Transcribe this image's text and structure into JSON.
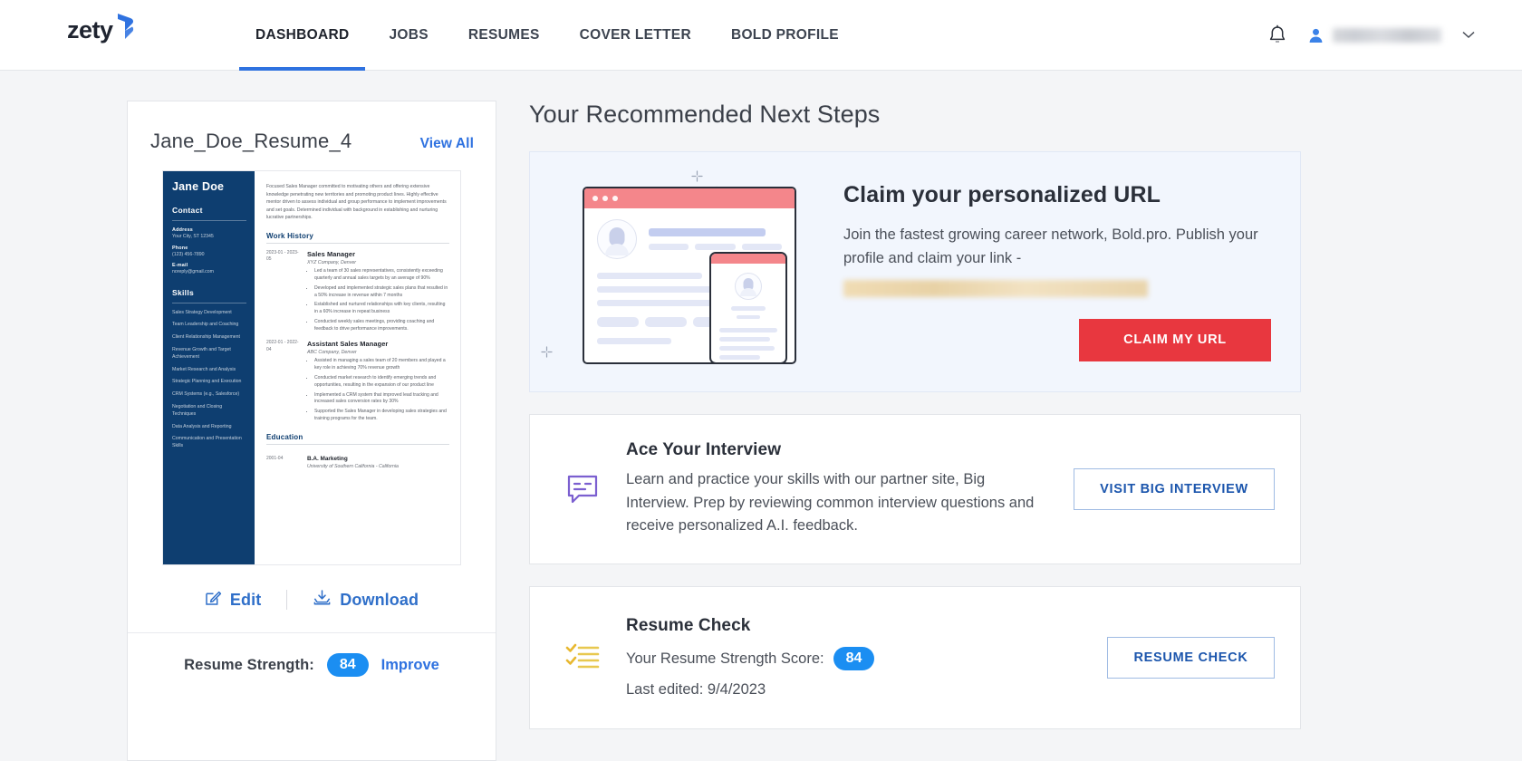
{
  "header": {
    "logo_text": "zety",
    "nav": [
      {
        "label": "DASHBOARD",
        "active": true
      },
      {
        "label": "JOBS",
        "active": false
      },
      {
        "label": "RESUMES",
        "active": false
      },
      {
        "label": "COVER LETTER",
        "active": false
      },
      {
        "label": "BOLD PROFILE",
        "active": false
      }
    ],
    "notification_icon": "bell-icon",
    "account_icon": "user-avatar-icon",
    "account_name_redacted": "",
    "dropdown_icon": "chevron-down-icon"
  },
  "resume_card": {
    "title": "Jane_Doe_Resume_4",
    "view_all_label": "View All",
    "edit_label": "Edit",
    "download_label": "Download",
    "strength_label": "Resume Strength:",
    "strength_score": "84",
    "improve_label": "Improve",
    "preview": {
      "name": "Jane Doe",
      "contact_heading": "Contact",
      "address_label": "Address",
      "address_value": "Your City, ST 12345",
      "phone_label": "Phone",
      "phone_value": "(123) 456-7890",
      "email_label": "E-mail",
      "email_value": "noreply@gmail.com",
      "skills_heading": "Skills",
      "skills": [
        "Sales Strategy Development",
        "Team Leadership and Coaching",
        "Client Relationship Management",
        "Revenue Growth and Target Achievement",
        "Market Research and Analysis",
        "Strategic Planning and Execution",
        "CRM Systems (e.g., Salesforce)",
        "Negotiation and Closing Techniques",
        "Data Analysis and Reporting",
        "Communication and Presentation Skills"
      ],
      "summary": "Focused Sales Manager committed to motivating others and offering extensive knowledge penetrating new territories and promoting product lines. Highly effective mentor driven to assess individual and group performance to implement improvements and set goals. Determined individual with background in establishing and nurturing lucrative partnerships.",
      "work_heading": "Work History",
      "jobs": [
        {
          "dates": "2023-01 - 2023-05",
          "title": "Sales Manager",
          "company": "XYZ Company, Denver",
          "bullets": [
            "Led a team of 30 sales representatives, consistently exceeding quarterly and annual sales targets by an average of 90%",
            "Developed and implemented strategic sales plans that resulted in a 50% increase in revenue within 7 months",
            "Established and nurtured relationships with key clients, resulting in a 60% increase in repeat business",
            "Conducted weekly sales meetings, providing coaching and feedback to drive performance improvements."
          ]
        },
        {
          "dates": "2022-01 - 2022-04",
          "title": "Assistant Sales Manager",
          "company": "ABC Company, Denver",
          "bullets": [
            "Assisted in managing a sales team of 20 members and played a key role in achieving 70% revenue growth",
            "Conducted market research to identify emerging trends and opportunities, resulting in the expansion of our product line",
            "Implemented a CRM system that improved lead tracking and increased sales conversion rates by 30%",
            "Supported the Sales Manager in developing sales strategies and training programs for the team."
          ]
        }
      ],
      "education_heading": "Education",
      "education_dates": "2001-04",
      "education_degree": "B.A. Marketing",
      "education_school": "University of Southern California - California"
    }
  },
  "main": {
    "title": "Your Recommended Next Steps",
    "url_card": {
      "heading": "Claim your personalized URL",
      "paragraph": "Join the fastest growing career network, Bold.pro. Publish your profile and claim your link -",
      "link_redacted": "",
      "button_label": "CLAIM MY URL",
      "illustration": "browser-profile-illustration"
    },
    "interview_card": {
      "icon": "chat-bubble-icon",
      "heading": "Ace Your Interview",
      "paragraph": "Learn and practice your skills with our partner site, Big Interview. Prep by reviewing common interview questions and receive personalized A.I. feedback.",
      "button_label": "VISIT BIG INTERVIEW"
    },
    "resume_check_card": {
      "icon": "checklist-icon",
      "heading": "Resume Check",
      "score_label": "Your Resume Strength Score:",
      "score_value": "84",
      "last_edited": "Last edited: 9/4/2023",
      "button_label": "RESUME CHECK"
    }
  },
  "colors": {
    "brand_blue": "#2f72e0",
    "accent_red": "#e8373f",
    "score_blue": "#1b8ef2",
    "resume_navy": "#0e3e70",
    "purple_icon": "#7b5fd0",
    "gold_icon": "#e8b830"
  }
}
